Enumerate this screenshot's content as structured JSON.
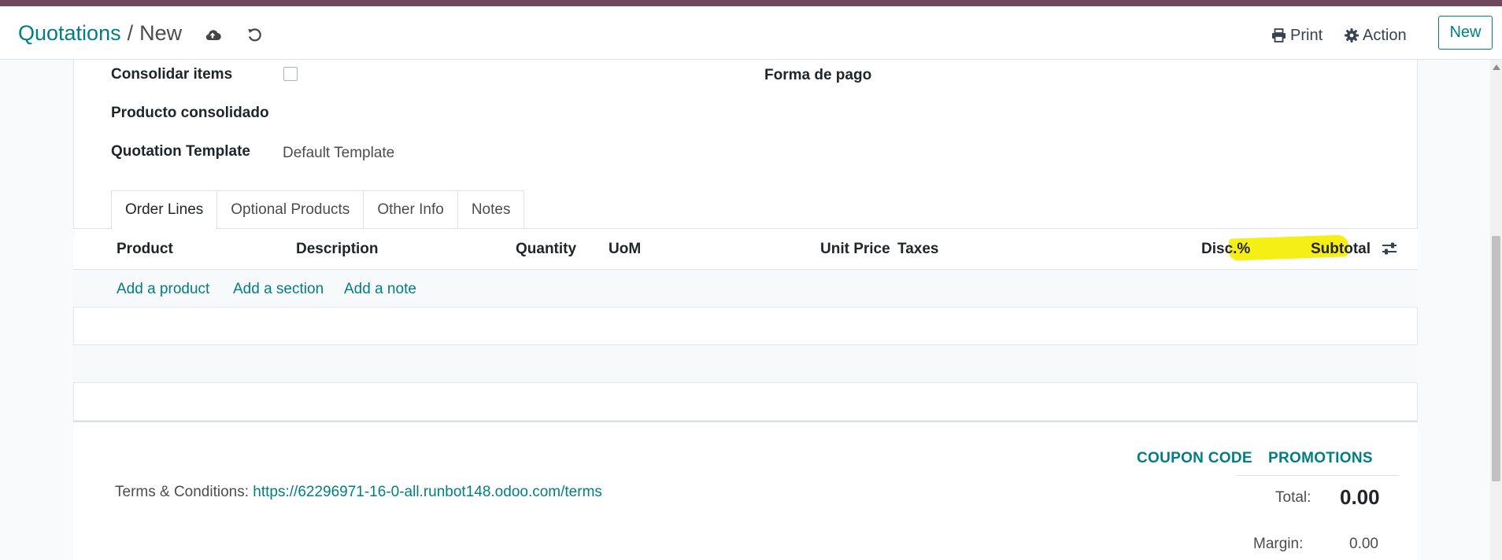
{
  "colors": {
    "brand_bar": "#71465f",
    "accent": "#017e84",
    "highlight": "#f5ef16"
  },
  "breadcrumb": {
    "parent": "Quotations",
    "separator": "/",
    "current": "New"
  },
  "icons": {
    "save": "cloud-upload-icon",
    "discard": "undo-icon",
    "print": "print-icon",
    "action": "gear-icon",
    "optional_columns": "sliders-icon"
  },
  "toolbar": {
    "print_label": "Print",
    "action_label": "Action",
    "new_label": "New"
  },
  "form": {
    "consolidar_label": "Consolidar items",
    "consolidar_checked": false,
    "producto_label": "Producto consolidado",
    "template_label": "Quotation Template",
    "template_value": "Default Template",
    "forma_pago_label": "Forma de pago"
  },
  "tabs": [
    {
      "label": "Order Lines",
      "active": true
    },
    {
      "label": "Optional Products",
      "active": false
    },
    {
      "label": "Other Info",
      "active": false
    },
    {
      "label": "Notes",
      "active": false
    }
  ],
  "order_lines": {
    "columns": [
      "Product",
      "Description",
      "Quantity",
      "UoM",
      "Unit Price",
      "Taxes",
      "Disc.%",
      "Subtotal"
    ],
    "add_product": "Add a product",
    "add_section": "Add a section",
    "add_note": "Add a note"
  },
  "footer": {
    "coupon_code": "COUPON CODE",
    "promotions": "PROMOTIONS",
    "terms_label": "Terms & Conditions:",
    "terms_url": "https://62296971-16-0-all.runbot148.odoo.com/terms",
    "total_label": "Total:",
    "total_value": "0.00",
    "margin_label": "Margin:",
    "margin_value": "0.00"
  }
}
